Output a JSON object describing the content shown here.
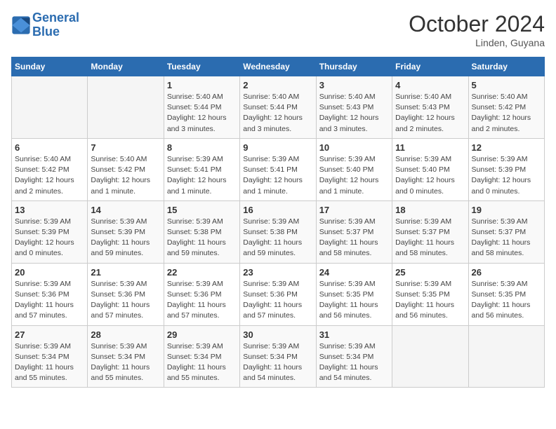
{
  "header": {
    "logo_line1": "General",
    "logo_line2": "Blue",
    "month_title": "October 2024",
    "location": "Linden, Guyana"
  },
  "weekdays": [
    "Sunday",
    "Monday",
    "Tuesday",
    "Wednesday",
    "Thursday",
    "Friday",
    "Saturday"
  ],
  "weeks": [
    [
      {
        "day": "",
        "details": ""
      },
      {
        "day": "",
        "details": ""
      },
      {
        "day": "1",
        "details": "Sunrise: 5:40 AM\nSunset: 5:44 PM\nDaylight: 12 hours\nand 3 minutes."
      },
      {
        "day": "2",
        "details": "Sunrise: 5:40 AM\nSunset: 5:44 PM\nDaylight: 12 hours\nand 3 minutes."
      },
      {
        "day": "3",
        "details": "Sunrise: 5:40 AM\nSunset: 5:43 PM\nDaylight: 12 hours\nand 3 minutes."
      },
      {
        "day": "4",
        "details": "Sunrise: 5:40 AM\nSunset: 5:43 PM\nDaylight: 12 hours\nand 2 minutes."
      },
      {
        "day": "5",
        "details": "Sunrise: 5:40 AM\nSunset: 5:42 PM\nDaylight: 12 hours\nand 2 minutes."
      }
    ],
    [
      {
        "day": "6",
        "details": "Sunrise: 5:40 AM\nSunset: 5:42 PM\nDaylight: 12 hours\nand 2 minutes."
      },
      {
        "day": "7",
        "details": "Sunrise: 5:40 AM\nSunset: 5:42 PM\nDaylight: 12 hours\nand 1 minute."
      },
      {
        "day": "8",
        "details": "Sunrise: 5:39 AM\nSunset: 5:41 PM\nDaylight: 12 hours\nand 1 minute."
      },
      {
        "day": "9",
        "details": "Sunrise: 5:39 AM\nSunset: 5:41 PM\nDaylight: 12 hours\nand 1 minute."
      },
      {
        "day": "10",
        "details": "Sunrise: 5:39 AM\nSunset: 5:40 PM\nDaylight: 12 hours\nand 1 minute."
      },
      {
        "day": "11",
        "details": "Sunrise: 5:39 AM\nSunset: 5:40 PM\nDaylight: 12 hours\nand 0 minutes."
      },
      {
        "day": "12",
        "details": "Sunrise: 5:39 AM\nSunset: 5:39 PM\nDaylight: 12 hours\nand 0 minutes."
      }
    ],
    [
      {
        "day": "13",
        "details": "Sunrise: 5:39 AM\nSunset: 5:39 PM\nDaylight: 12 hours\nand 0 minutes."
      },
      {
        "day": "14",
        "details": "Sunrise: 5:39 AM\nSunset: 5:39 PM\nDaylight: 11 hours\nand 59 minutes."
      },
      {
        "day": "15",
        "details": "Sunrise: 5:39 AM\nSunset: 5:38 PM\nDaylight: 11 hours\nand 59 minutes."
      },
      {
        "day": "16",
        "details": "Sunrise: 5:39 AM\nSunset: 5:38 PM\nDaylight: 11 hours\nand 59 minutes."
      },
      {
        "day": "17",
        "details": "Sunrise: 5:39 AM\nSunset: 5:37 PM\nDaylight: 11 hours\nand 58 minutes."
      },
      {
        "day": "18",
        "details": "Sunrise: 5:39 AM\nSunset: 5:37 PM\nDaylight: 11 hours\nand 58 minutes."
      },
      {
        "day": "19",
        "details": "Sunrise: 5:39 AM\nSunset: 5:37 PM\nDaylight: 11 hours\nand 58 minutes."
      }
    ],
    [
      {
        "day": "20",
        "details": "Sunrise: 5:39 AM\nSunset: 5:36 PM\nDaylight: 11 hours\nand 57 minutes."
      },
      {
        "day": "21",
        "details": "Sunrise: 5:39 AM\nSunset: 5:36 PM\nDaylight: 11 hours\nand 57 minutes."
      },
      {
        "day": "22",
        "details": "Sunrise: 5:39 AM\nSunset: 5:36 PM\nDaylight: 11 hours\nand 57 minutes."
      },
      {
        "day": "23",
        "details": "Sunrise: 5:39 AM\nSunset: 5:36 PM\nDaylight: 11 hours\nand 57 minutes."
      },
      {
        "day": "24",
        "details": "Sunrise: 5:39 AM\nSunset: 5:35 PM\nDaylight: 11 hours\nand 56 minutes."
      },
      {
        "day": "25",
        "details": "Sunrise: 5:39 AM\nSunset: 5:35 PM\nDaylight: 11 hours\nand 56 minutes."
      },
      {
        "day": "26",
        "details": "Sunrise: 5:39 AM\nSunset: 5:35 PM\nDaylight: 11 hours\nand 56 minutes."
      }
    ],
    [
      {
        "day": "27",
        "details": "Sunrise: 5:39 AM\nSunset: 5:34 PM\nDaylight: 11 hours\nand 55 minutes."
      },
      {
        "day": "28",
        "details": "Sunrise: 5:39 AM\nSunset: 5:34 PM\nDaylight: 11 hours\nand 55 minutes."
      },
      {
        "day": "29",
        "details": "Sunrise: 5:39 AM\nSunset: 5:34 PM\nDaylight: 11 hours\nand 55 minutes."
      },
      {
        "day": "30",
        "details": "Sunrise: 5:39 AM\nSunset: 5:34 PM\nDaylight: 11 hours\nand 54 minutes."
      },
      {
        "day": "31",
        "details": "Sunrise: 5:39 AM\nSunset: 5:34 PM\nDaylight: 11 hours\nand 54 minutes."
      },
      {
        "day": "",
        "details": ""
      },
      {
        "day": "",
        "details": ""
      }
    ]
  ]
}
